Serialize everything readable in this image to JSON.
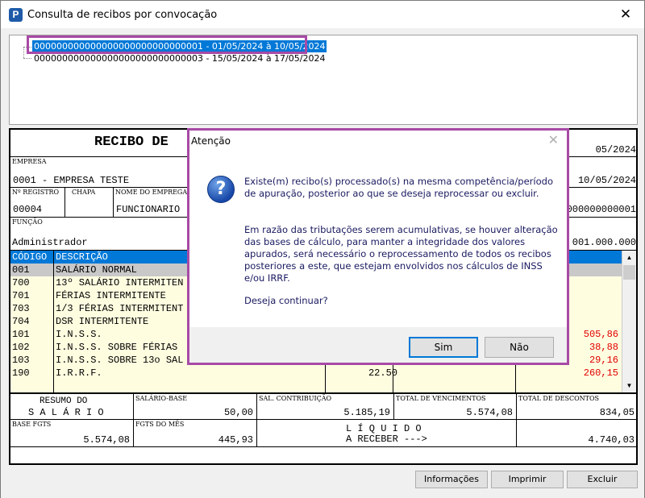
{
  "window": {
    "title": "Consulta de recibos por convocação",
    "icon_letter": "P",
    "close_glyph": "✕"
  },
  "tree": {
    "items": [
      {
        "label": "000000000000000000000000000001 - 01/05/2024 à 10/05/2024",
        "selected": true
      },
      {
        "label": "000000000000000000000000000003 - 15/05/2024 à 17/05/2024",
        "selected": false
      }
    ]
  },
  "receipt": {
    "title": "RECIBO DE",
    "period": "05/2024",
    "empresa_label": "EMPRESA",
    "empresa_value": "0001 - EMPRESA TESTE",
    "date_end": "10/05/2024",
    "registro_label": "Nº REGISTRO",
    "chapa_label": "CHAPA",
    "nome_label": "NOME DO EMPREGADO",
    "registro_value": "00004",
    "nome_value": "FUNCIONARIO",
    "id_value": "000000000001",
    "funcao_label": "FUNÇÃO",
    "funcao_value": "Administrador",
    "id2_value": "001.000.000",
    "col_codigo": "CÓDIGO",
    "col_descricao": "DESCRIÇÃO",
    "rows": [
      {
        "code": "001",
        "desc": "SALÁRIO NORMAL",
        "ref": "",
        "desconto": ""
      },
      {
        "code": "700",
        "desc": "13º SALÁRIO INTERMITEN",
        "ref": "",
        "desconto": ""
      },
      {
        "code": "701",
        "desc": "FÉRIAS INTERMITENTE",
        "ref": "",
        "desconto": ""
      },
      {
        "code": "703",
        "desc": "1/3 FÉRIAS INTERMITENT",
        "ref": "",
        "desconto": ""
      },
      {
        "code": "704",
        "desc": "DSR INTERMITENTE",
        "ref": "",
        "desconto": ""
      },
      {
        "code": "101",
        "desc": "I.N.S.S.",
        "ref": "",
        "desconto": "505,86"
      },
      {
        "code": "102",
        "desc": "I.N.S.S. SOBRE FÉRIAS",
        "ref": "",
        "desconto": "38,88"
      },
      {
        "code": "103",
        "desc": "I.N.S.S. SOBRE 13o SAL",
        "ref": "",
        "desconto": "29,16"
      },
      {
        "code": "190",
        "desc": "I.R.R.F.",
        "ref": "22.50",
        "desconto": "260,15"
      }
    ],
    "resumo_line1": "RESUMO DO",
    "resumo_line2": "S A L Á R I O",
    "salario_base_label": "SALÁRIO-BASE",
    "salario_base_value": "50,00",
    "sal_contrib_label": "SAL. CONTRIBUIÇÃO",
    "sal_contrib_value": "5.185,19",
    "total_venc_label": "TOTAL DE VENCIMENTOS",
    "total_venc_value": "5.574,08",
    "total_desc_label": "TOTAL DE DESCONTOS",
    "total_desc_value": "834,05",
    "base_fgts_label": "BASE FGTS",
    "base_fgts_value": "5.574,08",
    "fgts_mes_label": "FGTS DO MÊS",
    "fgts_mes_value": "445,93",
    "liquido_line1": "L Í Q U I D O",
    "liquido_line2": "A RECEBER --->",
    "liquido_value": "4.740,03"
  },
  "buttons": {
    "informacoes": "Informações",
    "imprimir": "Imprimir",
    "excluir": "Excluir"
  },
  "dialog": {
    "title": "Atenção",
    "close_glyph": "✕",
    "icon_glyph": "?",
    "para1": "Existe(m) recibo(s) processado(s) na mesma competência/período de apuração, posterior ao que se deseja reprocessar ou excluir.",
    "para2": "Em razão das tributações serem acumulativas, se houver alteração das bases de cálculo, para manter a integridade dos valores apurados, será necessário o reprocessamento de todos os recibos posteriores a este, que estejam envolvidos nos cálculos de INSS e/ou IRRF.",
    "para3": "Deseja continuar?",
    "yes": "Sim",
    "no": "Não"
  },
  "colors": {
    "selection": "#0078d7",
    "highlight_box": "#a84aa6",
    "yellow_row": "#fffde0",
    "gray_row": "#c8c8c8",
    "discount_red": "#e00000"
  }
}
